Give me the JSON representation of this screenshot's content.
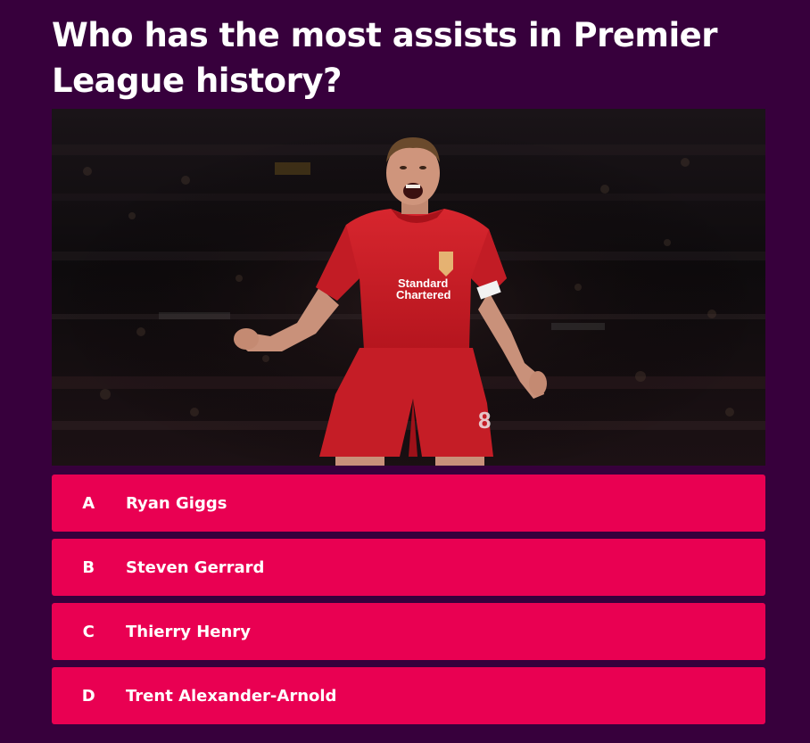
{
  "question": {
    "text": "Who has the most assists in Premier League history?"
  },
  "image": {
    "alt": "Footballer in red Liverpool kit celebrating",
    "shirt_sponsor_line1": "Standard",
    "shirt_sponsor_line2": "Chartered",
    "shorts_number": "8"
  },
  "answers": [
    {
      "letter": "A",
      "text": "Ryan Giggs"
    },
    {
      "letter": "B",
      "text": "Steven Gerrard"
    },
    {
      "letter": "C",
      "text": "Thierry Henry"
    },
    {
      "letter": "D",
      "text": "Trent Alexander-Arnold"
    }
  ],
  "colors": {
    "background": "#37003c",
    "answer_background": "#e90052",
    "text": "#ffffff"
  }
}
